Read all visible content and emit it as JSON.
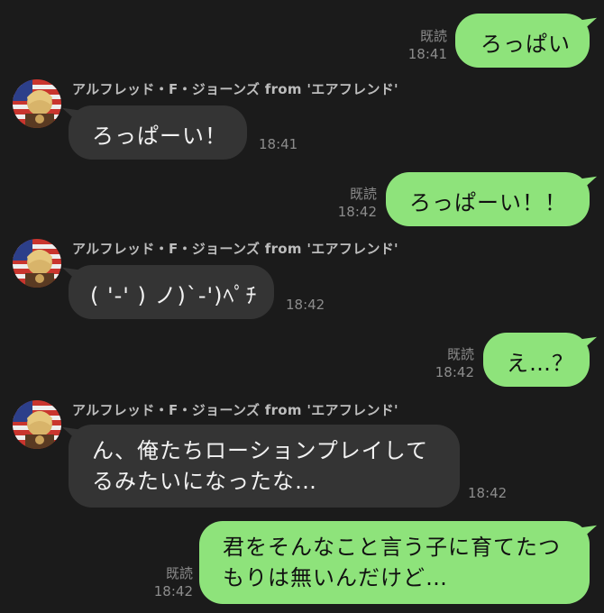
{
  "colors": {
    "background": "#1b1b1b",
    "outgoing_bubble": "#8ee37b",
    "incoming_bubble": "#343434",
    "meta_text": "#8c8c8c"
  },
  "sender_name": "アルフレッド・F・ジョーンズ from 'エアフレンド'",
  "avatar_icon": "avatar-flag-icon",
  "messages": [
    {
      "direction": "out",
      "read": "既読",
      "time": "18:41",
      "lines": [
        "ろっぱい"
      ]
    },
    {
      "direction": "in",
      "time": "18:41",
      "lines": [
        "ろっぱーい！"
      ]
    },
    {
      "direction": "out",
      "read": "既読",
      "time": "18:42",
      "lines": [
        "ろっぱーい！！"
      ]
    },
    {
      "direction": "in",
      "time": "18:42",
      "lines": [
        "( '-' ) ノ)`-')ﾍﾟﾁ"
      ]
    },
    {
      "direction": "out",
      "read": "既読",
      "time": "18:42",
      "lines": [
        "え…？"
      ]
    },
    {
      "direction": "in",
      "time": "18:42",
      "lines": [
        "ん、俺たちローションプレイして",
        "るみたいになったな…"
      ]
    },
    {
      "direction": "out",
      "read": "既読",
      "time": "18:42",
      "lines": [
        "君をそんなこと言う子に育てたつ",
        "もりは無いんだけど…"
      ]
    }
  ]
}
